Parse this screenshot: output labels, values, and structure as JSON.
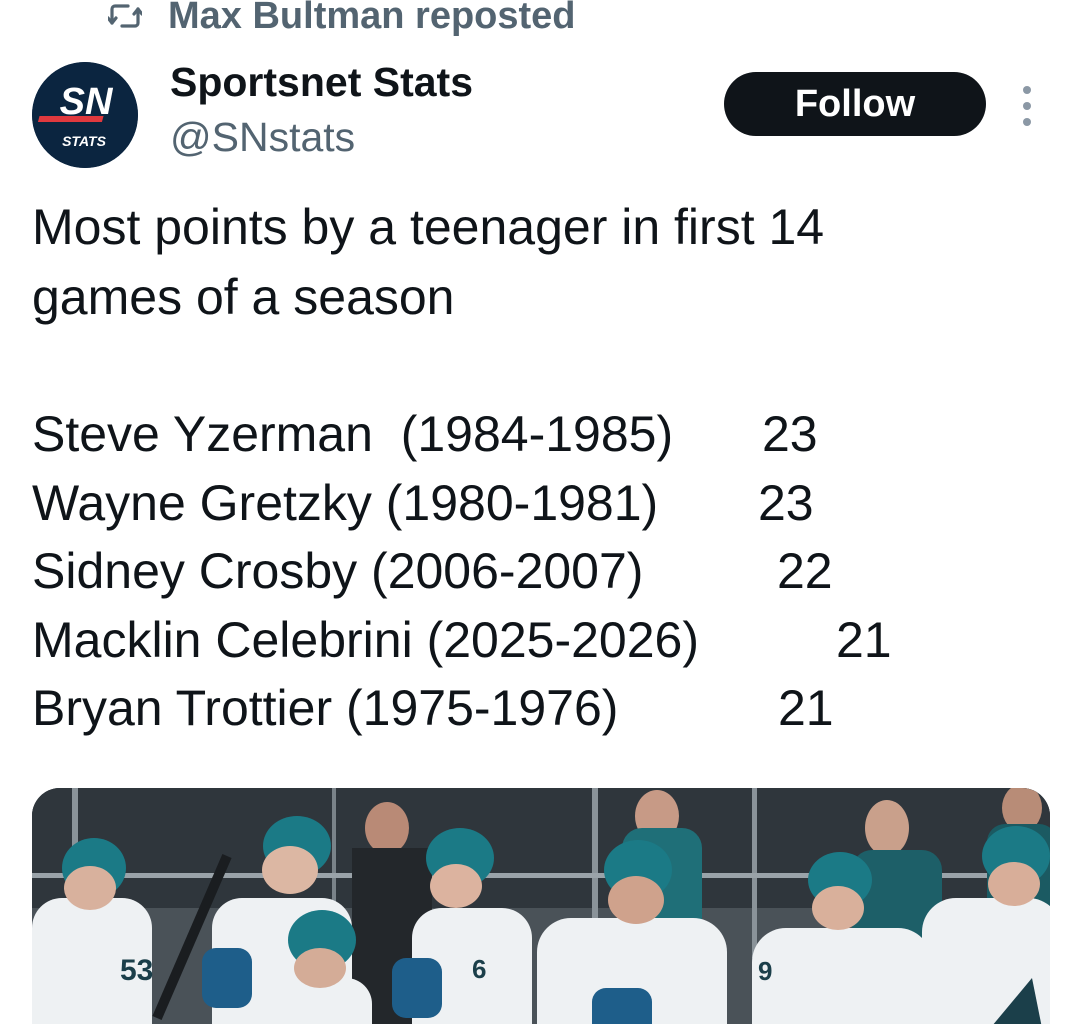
{
  "repost": {
    "icon": "repost-icon",
    "text": "Max Bultman reposted"
  },
  "author": {
    "avatar_icon": "sportsnet-stats-logo",
    "avatar_logo_text": "SN",
    "avatar_sub_text": "STATS",
    "name": "Sportsnet Stats",
    "handle": "@SNstats"
  },
  "follow_label": "Follow",
  "more_icon": "more-options-icon",
  "tweet": {
    "line1": "Most points by a teenager in first 14",
    "line2": "games of a season",
    "stats": [
      {
        "player": "Steve Yzerman  (1984-1985)",
        "points": "23"
      },
      {
        "player": "Wayne Gretzky (1980-1981)",
        "points": "23"
      },
      {
        "player": "Sidney Crosby (2006-2007)",
        "points": "22"
      },
      {
        "player": "Macklin Celebrini (2025-2026)",
        "points": "21"
      },
      {
        "player": "Bryan Trottier (1975-1976)",
        "points": "21"
      }
    ]
  },
  "colors": {
    "text": "#0f1419",
    "secondary": "#536471",
    "follow_bg": "#0f1419",
    "sharks_teal": "#1b6f7a"
  }
}
